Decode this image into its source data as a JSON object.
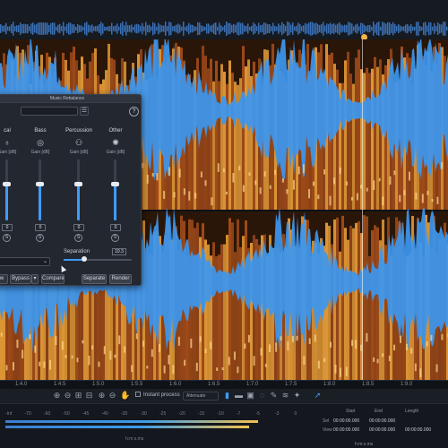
{
  "dialog": {
    "title": "Music Rebalance",
    "help_label": "?",
    "menu_label": "☰",
    "stems": [
      {
        "name": "cal",
        "gain_label": "Gain [dB]",
        "value": "0",
        "solo": "S",
        "level": 0.6,
        "icon": "microphone-icon"
      },
      {
        "name": "Bass",
        "gain_label": "Gain [dB]",
        "value": "0",
        "solo": "S",
        "level": 0.6,
        "icon": "bass-icon"
      },
      {
        "name": "Percussion",
        "gain_label": "Gain [dB]",
        "value": "0",
        "solo": "S",
        "level": 0.6,
        "icon": "drum-icon"
      },
      {
        "name": "Other",
        "gain_label": "Gain [dB]",
        "value": "0",
        "solo": "S",
        "level": 0.6,
        "icon": "other-icon"
      }
    ],
    "quality_label": "y",
    "separation_label": "Separation",
    "separation_value": "10.3",
    "separation_level": 0.3,
    "buttons": {
      "preview": "w",
      "bypass": "Bypass",
      "compare": "Compare",
      "separate": "Separate",
      "render": "Render"
    }
  },
  "view_toolbar": {
    "instant_process_label": "Instant process",
    "mode_value": "Attenuate"
  },
  "ruler": {
    "labels": [
      "1:4.0",
      "1:4.5",
      "1:5.0",
      "1:5.5",
      "1:6.0",
      "1:6.5",
      "1:7.0",
      "1:7.5",
      "1:8.0",
      "1:8.5",
      "1:9.0"
    ]
  },
  "meter": {
    "ticks": [
      "-Inf",
      "-70",
      "-60",
      "-50",
      "-45",
      "-40",
      "-35",
      "-30",
      "-25",
      "-20",
      "-15",
      "-10",
      "-7",
      "-5",
      "-3",
      "0"
    ],
    "left_level": 0.83,
    "right_level": 0.8,
    "timecode_format": "h:m:s.ms"
  },
  "selection": {
    "headers": [
      "Start",
      "End",
      "Length"
    ],
    "rows": [
      {
        "label": "Sel",
        "start": "00:00:00.000",
        "end": "00:00:00.000",
        "length": ""
      },
      {
        "label": "View",
        "start": "00:00:00.000",
        "end": "00:00:00.000",
        "length": "00:00:00.000"
      }
    ],
    "format_label": "h:m:s.ms"
  },
  "colors": {
    "waveform": "#3c97f0",
    "spectro_hot": "#f3a53c",
    "spectro_warm": "#c45b1f",
    "accent": "#3f9bff"
  }
}
